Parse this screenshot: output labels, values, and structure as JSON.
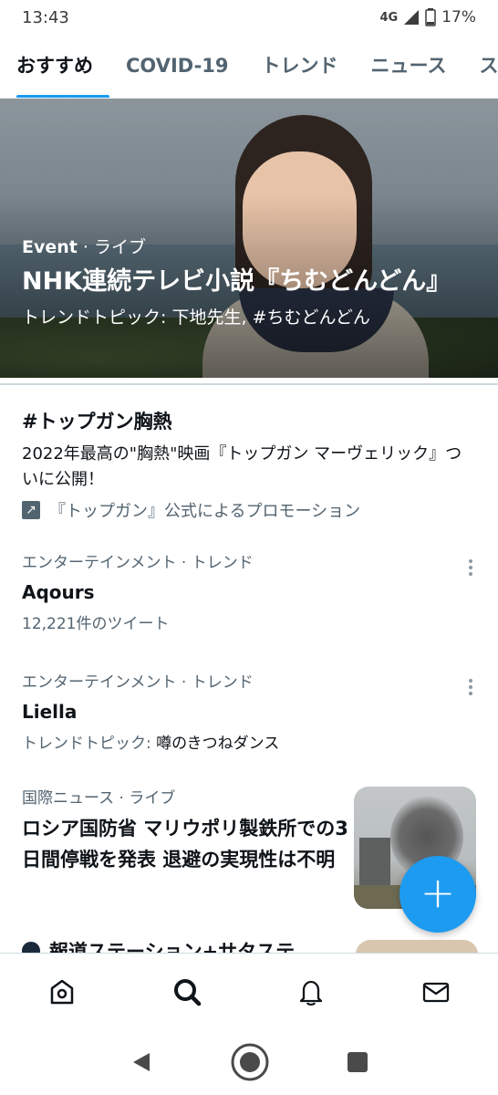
{
  "status_bar": {
    "time": "13:43",
    "network": "4G",
    "battery": "17%"
  },
  "tabs": [
    {
      "label": "おすすめ",
      "active": true
    },
    {
      "label": "COVID-19",
      "active": false
    },
    {
      "label": "トレンド",
      "active": false
    },
    {
      "label": "ニュース",
      "active": false
    },
    {
      "label": "ス",
      "active": false
    }
  ],
  "hero": {
    "event_label": "Event",
    "meta_suffix": " · ライブ",
    "title": "NHK連続テレビ小説『ちむどんどん』",
    "subtitle": "トレンドトピック: 下地先生, #ちむどんどん"
  },
  "promo": {
    "title": "#トップガン胸熱",
    "description": "2022年最高の\"胸熱\"映画『トップガン マーヴェリック』ついに公開！",
    "promoted_by": "『トップガン』公式によるプロモーション"
  },
  "trends": [
    {
      "category": "エンターテインメント · トレンド",
      "name": "Aqours",
      "count": "12,221件のツイート"
    },
    {
      "category": "エンターテインメント · トレンド",
      "name": "Liella",
      "topic_prefix": "トレンドトピック: ",
      "topic": "噂のきつねダンス"
    }
  ],
  "news": {
    "category": "国際ニュース · ライブ",
    "title": "ロシア国防省 マリウポリ製鉄所での3日間停戦を発表 退避の実現性は不明"
  },
  "next_item": {
    "source": "報道ステーション+サタステ"
  },
  "fab": {
    "label": "+"
  },
  "bottom_nav": [
    "home-icon",
    "search-icon",
    "bell-icon",
    "mail-icon"
  ],
  "system_nav": [
    "back-icon",
    "home-circle-icon",
    "recents-icon"
  ],
  "colors": {
    "accent": "#1d9bf0",
    "text": "#0f1419",
    "secondary": "#536471"
  }
}
